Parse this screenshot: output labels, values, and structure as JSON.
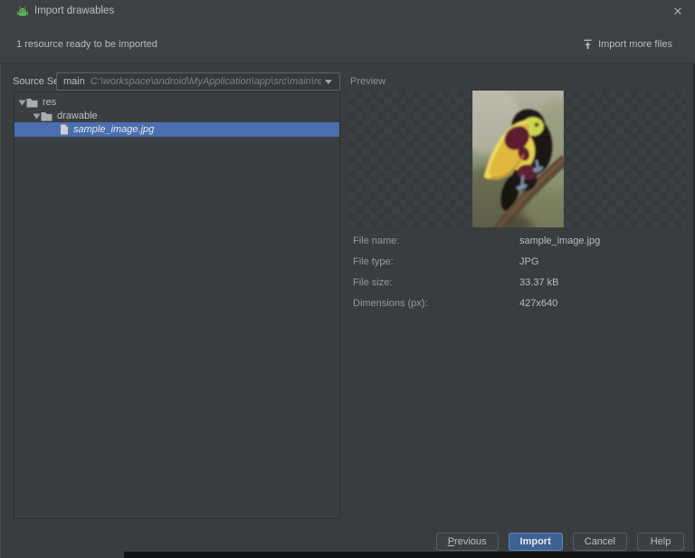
{
  "dialog": {
    "title": "Import drawables",
    "close_glyph": "✕"
  },
  "header": {
    "status": "1 resource ready to be imported",
    "import_more": {
      "label": "Import more files",
      "icon": "import-up-arrow"
    }
  },
  "source_set": {
    "label": "Source Set:",
    "value": "main",
    "path": "C:\\workspace\\android\\MyApplication\\app\\src\\main\\res"
  },
  "tree": {
    "items": [
      {
        "label": "res",
        "type": "folder",
        "level": 0,
        "expanded": true
      },
      {
        "label": "drawable",
        "type": "folder",
        "level": 1,
        "expanded": true
      },
      {
        "label": "sample_image.jpg",
        "type": "file",
        "level": 2,
        "selected": true
      }
    ]
  },
  "preview": {
    "label": "Preview",
    "image_alt": "Toucan perched on a branch",
    "details": [
      {
        "label": "File name:",
        "value": "sample_image.jpg"
      },
      {
        "label": "File type:",
        "value": "JPG"
      },
      {
        "label": "File size:",
        "value": "33.37 kB"
      },
      {
        "label": "Dimensions (px):",
        "value": "427x640"
      }
    ]
  },
  "footer": {
    "buttons": [
      {
        "label": "Previous",
        "mnemonic": "P"
      },
      {
        "label": "Import",
        "default": true
      },
      {
        "label": "Cancel"
      },
      {
        "label": "Help"
      }
    ]
  },
  "colors": {
    "selection_blue": "#4b6eaf",
    "default_button_blue": "#3d6294",
    "android_green": "#58b558"
  }
}
